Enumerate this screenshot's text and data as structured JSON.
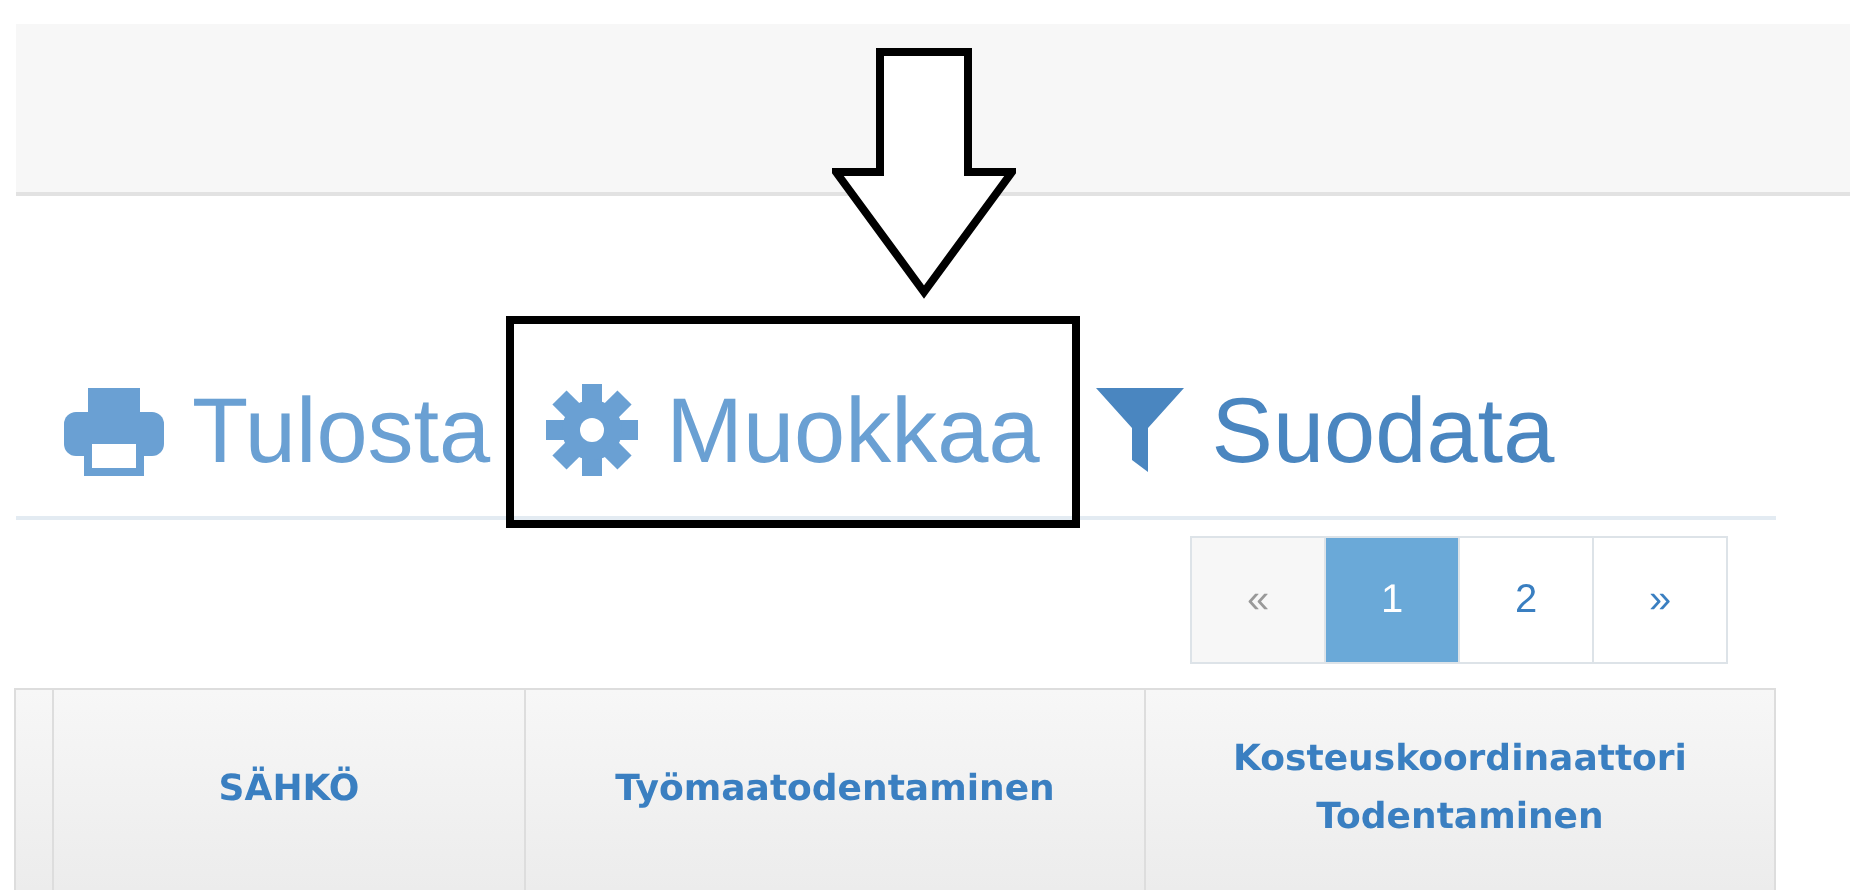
{
  "toolbar": [
    {
      "kind": "print",
      "label": "Tulosta",
      "highlighted": false
    },
    {
      "kind": "gear",
      "label": "Muokkaa",
      "highlighted": true
    },
    {
      "kind": "filter",
      "label": "Suodata",
      "highlighted": false
    }
  ],
  "pagination": [
    {
      "label": "«",
      "selected": false
    },
    {
      "label": "1",
      "selected": true
    },
    {
      "label": "2",
      "selected": false
    },
    {
      "label": "»",
      "selected": false
    }
  ],
  "table": {
    "columns": [
      "SÄHKÖ",
      "Työmaatodentaminen",
      "Kosteuskoordinaattori Todentaminen"
    ]
  }
}
